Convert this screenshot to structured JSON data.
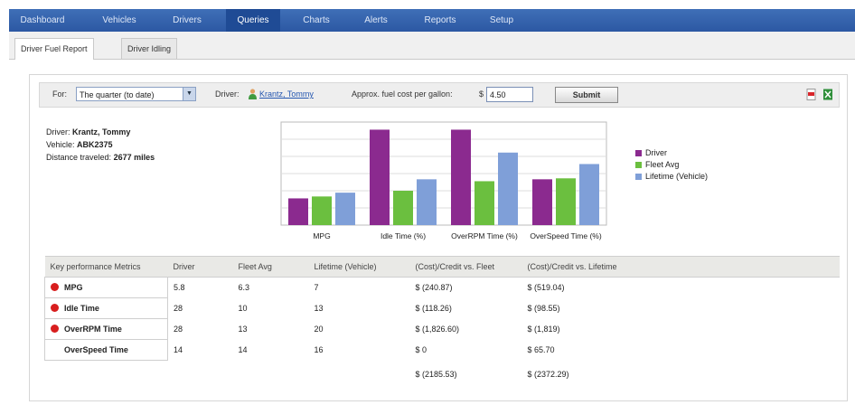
{
  "nav": {
    "items": [
      "Dashboard",
      "Vehicles",
      "Drivers",
      "Queries",
      "Charts",
      "Alerts",
      "Reports",
      "Setup"
    ],
    "active": "Queries"
  },
  "tabs": [
    "Driver Fuel Report",
    "Driver Idling"
  ],
  "filter": {
    "for_label": "For:",
    "period_value": "The quarter (to date)",
    "driver_label": "Driver:",
    "driver_link": "Krantz, Tommy",
    "cost_label": "Approx. fuel cost per gallon:",
    "currency": "$",
    "cost_value": "4.50",
    "submit": "Submit"
  },
  "driver_info": {
    "driver_label": "Driver:",
    "driver_name": "Krantz, Tommy",
    "vehicle_label": "Vehicle:",
    "vehicle_id": "ABK2375",
    "distance_label": "Distance traveled:",
    "distance_value": "2677 miles"
  },
  "chart_data": {
    "type": "bar",
    "categories": [
      "MPG",
      "Idle Time (%)",
      "OverRPM Time (%)",
      "OverSpeed Time (%)"
    ],
    "series": [
      {
        "name": "Driver",
        "color": "#8b2a8f",
        "values": [
          28,
          100,
          100,
          48
        ]
      },
      {
        "name": "Fleet Avg",
        "color": "#6bbf3f",
        "values": [
          30,
          36,
          46,
          49
        ]
      },
      {
        "name": "Lifetime (Vehicle)",
        "color": "#7f9fd8",
        "values": [
          34,
          48,
          76,
          64
        ]
      }
    ],
    "ylim": [
      0,
      108
    ],
    "grid": true,
    "legend": "right"
  },
  "table": {
    "headers": [
      "Key performance Metrics",
      "Driver",
      "Fleet Avg",
      "Lifetime (Vehicle)",
      "(Cost)/Credit vs. Fleet",
      "(Cost)/Credit vs. Lifetime"
    ],
    "rows": [
      {
        "flag": true,
        "cells": [
          "MPG",
          "5.8",
          "6.3",
          "7",
          "$ (240.87)",
          "$ (519.04)"
        ]
      },
      {
        "flag": true,
        "cells": [
          "Idle Time",
          "28",
          "10",
          "13",
          "$ (118.26)",
          "$ (98.55)"
        ]
      },
      {
        "flag": true,
        "cells": [
          "OverRPM Time",
          "28",
          "13",
          "20",
          "$ (1,826.60)",
          "$ (1,819)"
        ]
      },
      {
        "flag": false,
        "cells": [
          "OverSpeed Time",
          "14",
          "14",
          "16",
          "$ 0",
          "$ 65.70"
        ]
      }
    ],
    "totals": [
      "$ (2185.53)",
      "$ (2372.29)"
    ]
  },
  "icons": {
    "pdf": "pdf-icon",
    "excel": "excel-icon",
    "driver": "driver-person-icon"
  }
}
